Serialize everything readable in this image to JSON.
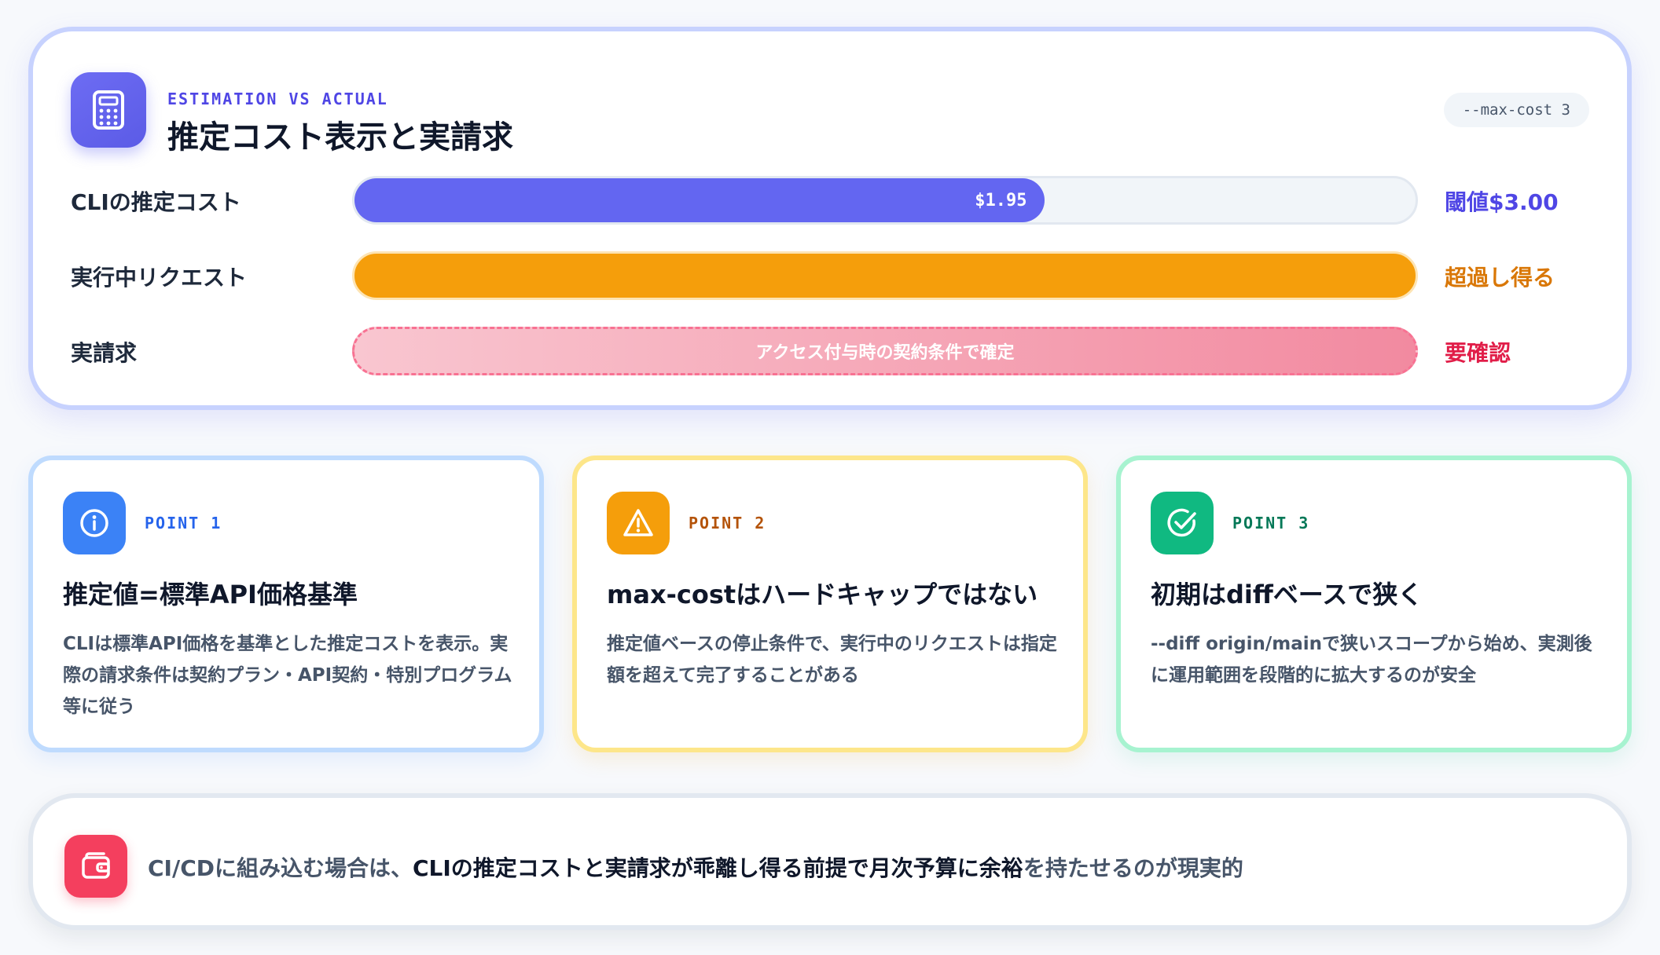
{
  "header": {
    "eyebrow": "ESTIMATION VS ACTUAL",
    "title": "推定コスト表示と実請求",
    "flag": "--max-cost 3",
    "icon": "calculator-icon"
  },
  "rows": [
    {
      "label": "CLIの推定コスト",
      "value_text": "$1.95",
      "progress": 0.65,
      "status": "閾値$3.00",
      "status_color": "#4f46e5",
      "bar_color": "#6366f1"
    },
    {
      "label": "実行中リクエスト",
      "progress": 1.0,
      "status": "超過し得る",
      "status_color": "#d97706",
      "bar_color": "#f59e0b"
    },
    {
      "label": "実請求",
      "bar_text": "アクセス付与時の契約条件で確定",
      "status": "要確認",
      "status_color": "#e11d48",
      "bar_color": "#f28aa0"
    }
  ],
  "points": [
    {
      "label": "POINT 1",
      "title": "推定値=標準API価格基準",
      "body": "CLIは標準API価格を基準とした推定コストを表示。実際の請求条件は契約プラン・API契約・特別プログラム等に従う",
      "icon": "info-icon",
      "accent": "#3b82f6",
      "label_color": "#2563eb"
    },
    {
      "label": "POINT 2",
      "title": "max-costはハードキャップではない",
      "body": "推定値ベースの停止条件で、実行中のリクエストは指定額を超えて完了することがある",
      "icon": "warning-icon",
      "accent": "#f59e0b",
      "label_color": "#b45309"
    },
    {
      "label": "POINT 3",
      "title": "初期はdiffベースで狭く",
      "body": "--diff origin/mainで狭いスコープから始め、実測後に運用範囲を段階的に拡大するのが安全",
      "icon": "check-circle-icon",
      "accent": "#10b981",
      "label_color": "#047857"
    }
  ],
  "banner": {
    "icon": "wallet-icon",
    "text_prefix": "CI/CDに組み込む場合は、",
    "text_strong": "CLIの推定コストと実請求が乖離し得る前提で月次予算に余裕",
    "text_suffix": "を持たせるのが現実的"
  }
}
